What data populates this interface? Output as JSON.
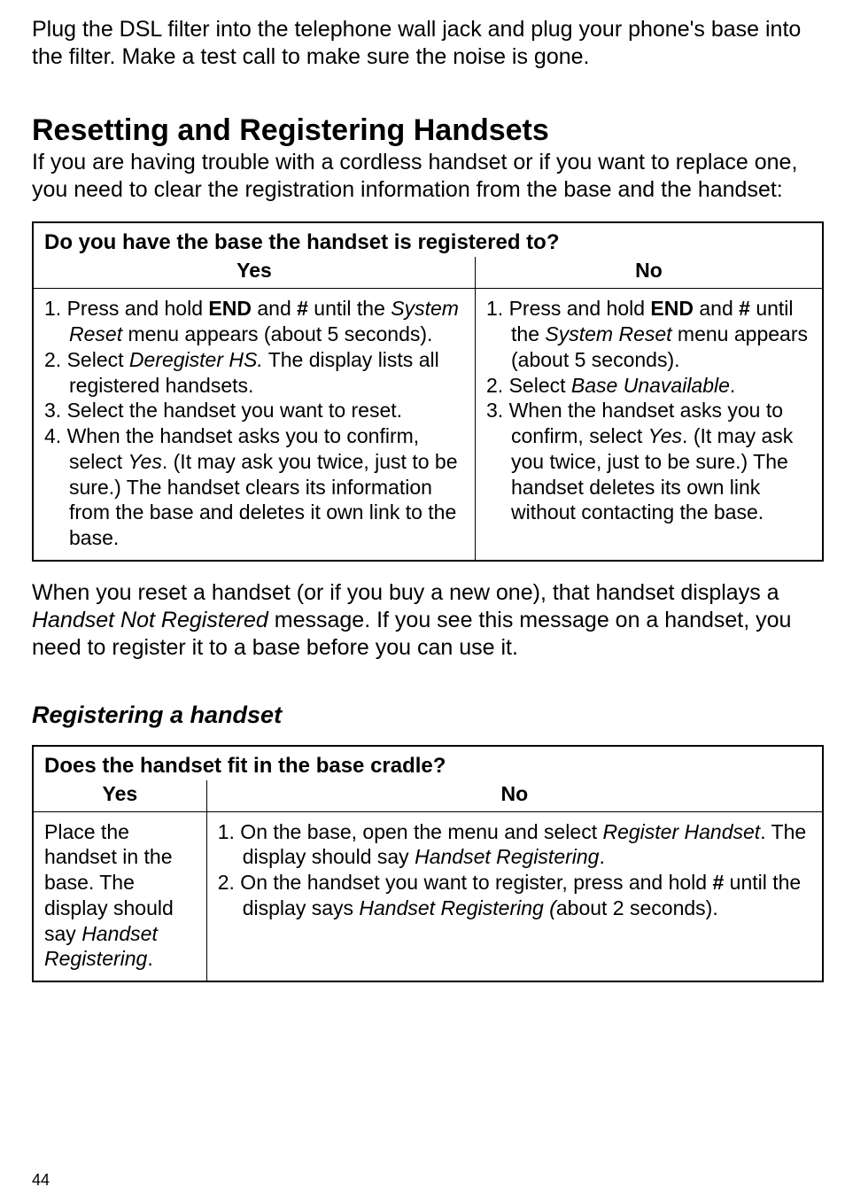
{
  "intro": "Plug the DSL filter into the telephone wall jack and plug your phone's base into the filter. Make a test call to make sure the noise is gone.",
  "section1": {
    "heading": "Resetting and Registering Handsets",
    "para": "If you are having trouble with a cordless handset or if you want to replace one, you need to clear the registration information from the base and the handset:"
  },
  "table1": {
    "title": "Do you have the base the handset is registered to?",
    "col_yes": "Yes",
    "col_no": "No",
    "yes_items": {
      "i1a": "1. Press and hold ",
      "i1b": "END",
      "i1c": " and ",
      "i1d": "#",
      "i1e": " until the ",
      "i1f": "System Reset",
      "i1g": " menu appears (about 5 seconds).",
      "i2a": "2. Select ",
      "i2b": "Deregister HS.",
      "i2c": " The display lists all registered handsets.",
      "i3": "3. Select the handset you want to reset.",
      "i4a": "4. When the handset asks you to confirm, select ",
      "i4b": "Yes",
      "i4c": ". (It may ask you twice, just to be sure.) The handset clears its information from the base and deletes it own link to the base."
    },
    "no_items": {
      "i1a": "1. Press and hold ",
      "i1b": "END",
      "i1c": " and ",
      "i1d": "#",
      "i1e": " until the ",
      "i1f": "System Reset",
      "i1g": " menu appears (about 5 seconds).",
      "i2a": "2. Select ",
      "i2b": "Base Unavailable",
      "i2c": ".",
      "i3a": "3. When the handset asks you to confirm, select ",
      "i3b": "Yes",
      "i3c": ". (It may ask you twice, just to be sure.) The handset deletes its own link without contacting the base."
    }
  },
  "mid_para_a": "When you reset a handset (or if you buy a new one), that handset displays a ",
  "mid_para_b": "Handset Not Registered",
  "mid_para_c": " message. If you see this message on a handset, you need to register it to a base before you can use it.",
  "section2_heading": "Registering a handset",
  "table2": {
    "title": "Does the handset fit in the base cradle?",
    "col_yes": "Yes",
    "col_no": "No",
    "yes_a": "Place the handset in the base. The display should say ",
    "yes_b": "Handset Registering",
    "yes_c": ".",
    "no_items": {
      "i1a": "1. On the base, open the menu and select ",
      "i1b": "Register Handset",
      "i1c": ". The display should say ",
      "i1d": "Handset Registering",
      "i1e": ".",
      "i2a": "2. On the handset you want to register, press and hold ",
      "i2b": "#",
      "i2c": " until the display says ",
      "i2d": "Handset Registering (",
      "i2e": "about 2 seconds)."
    }
  },
  "page_number": "44"
}
